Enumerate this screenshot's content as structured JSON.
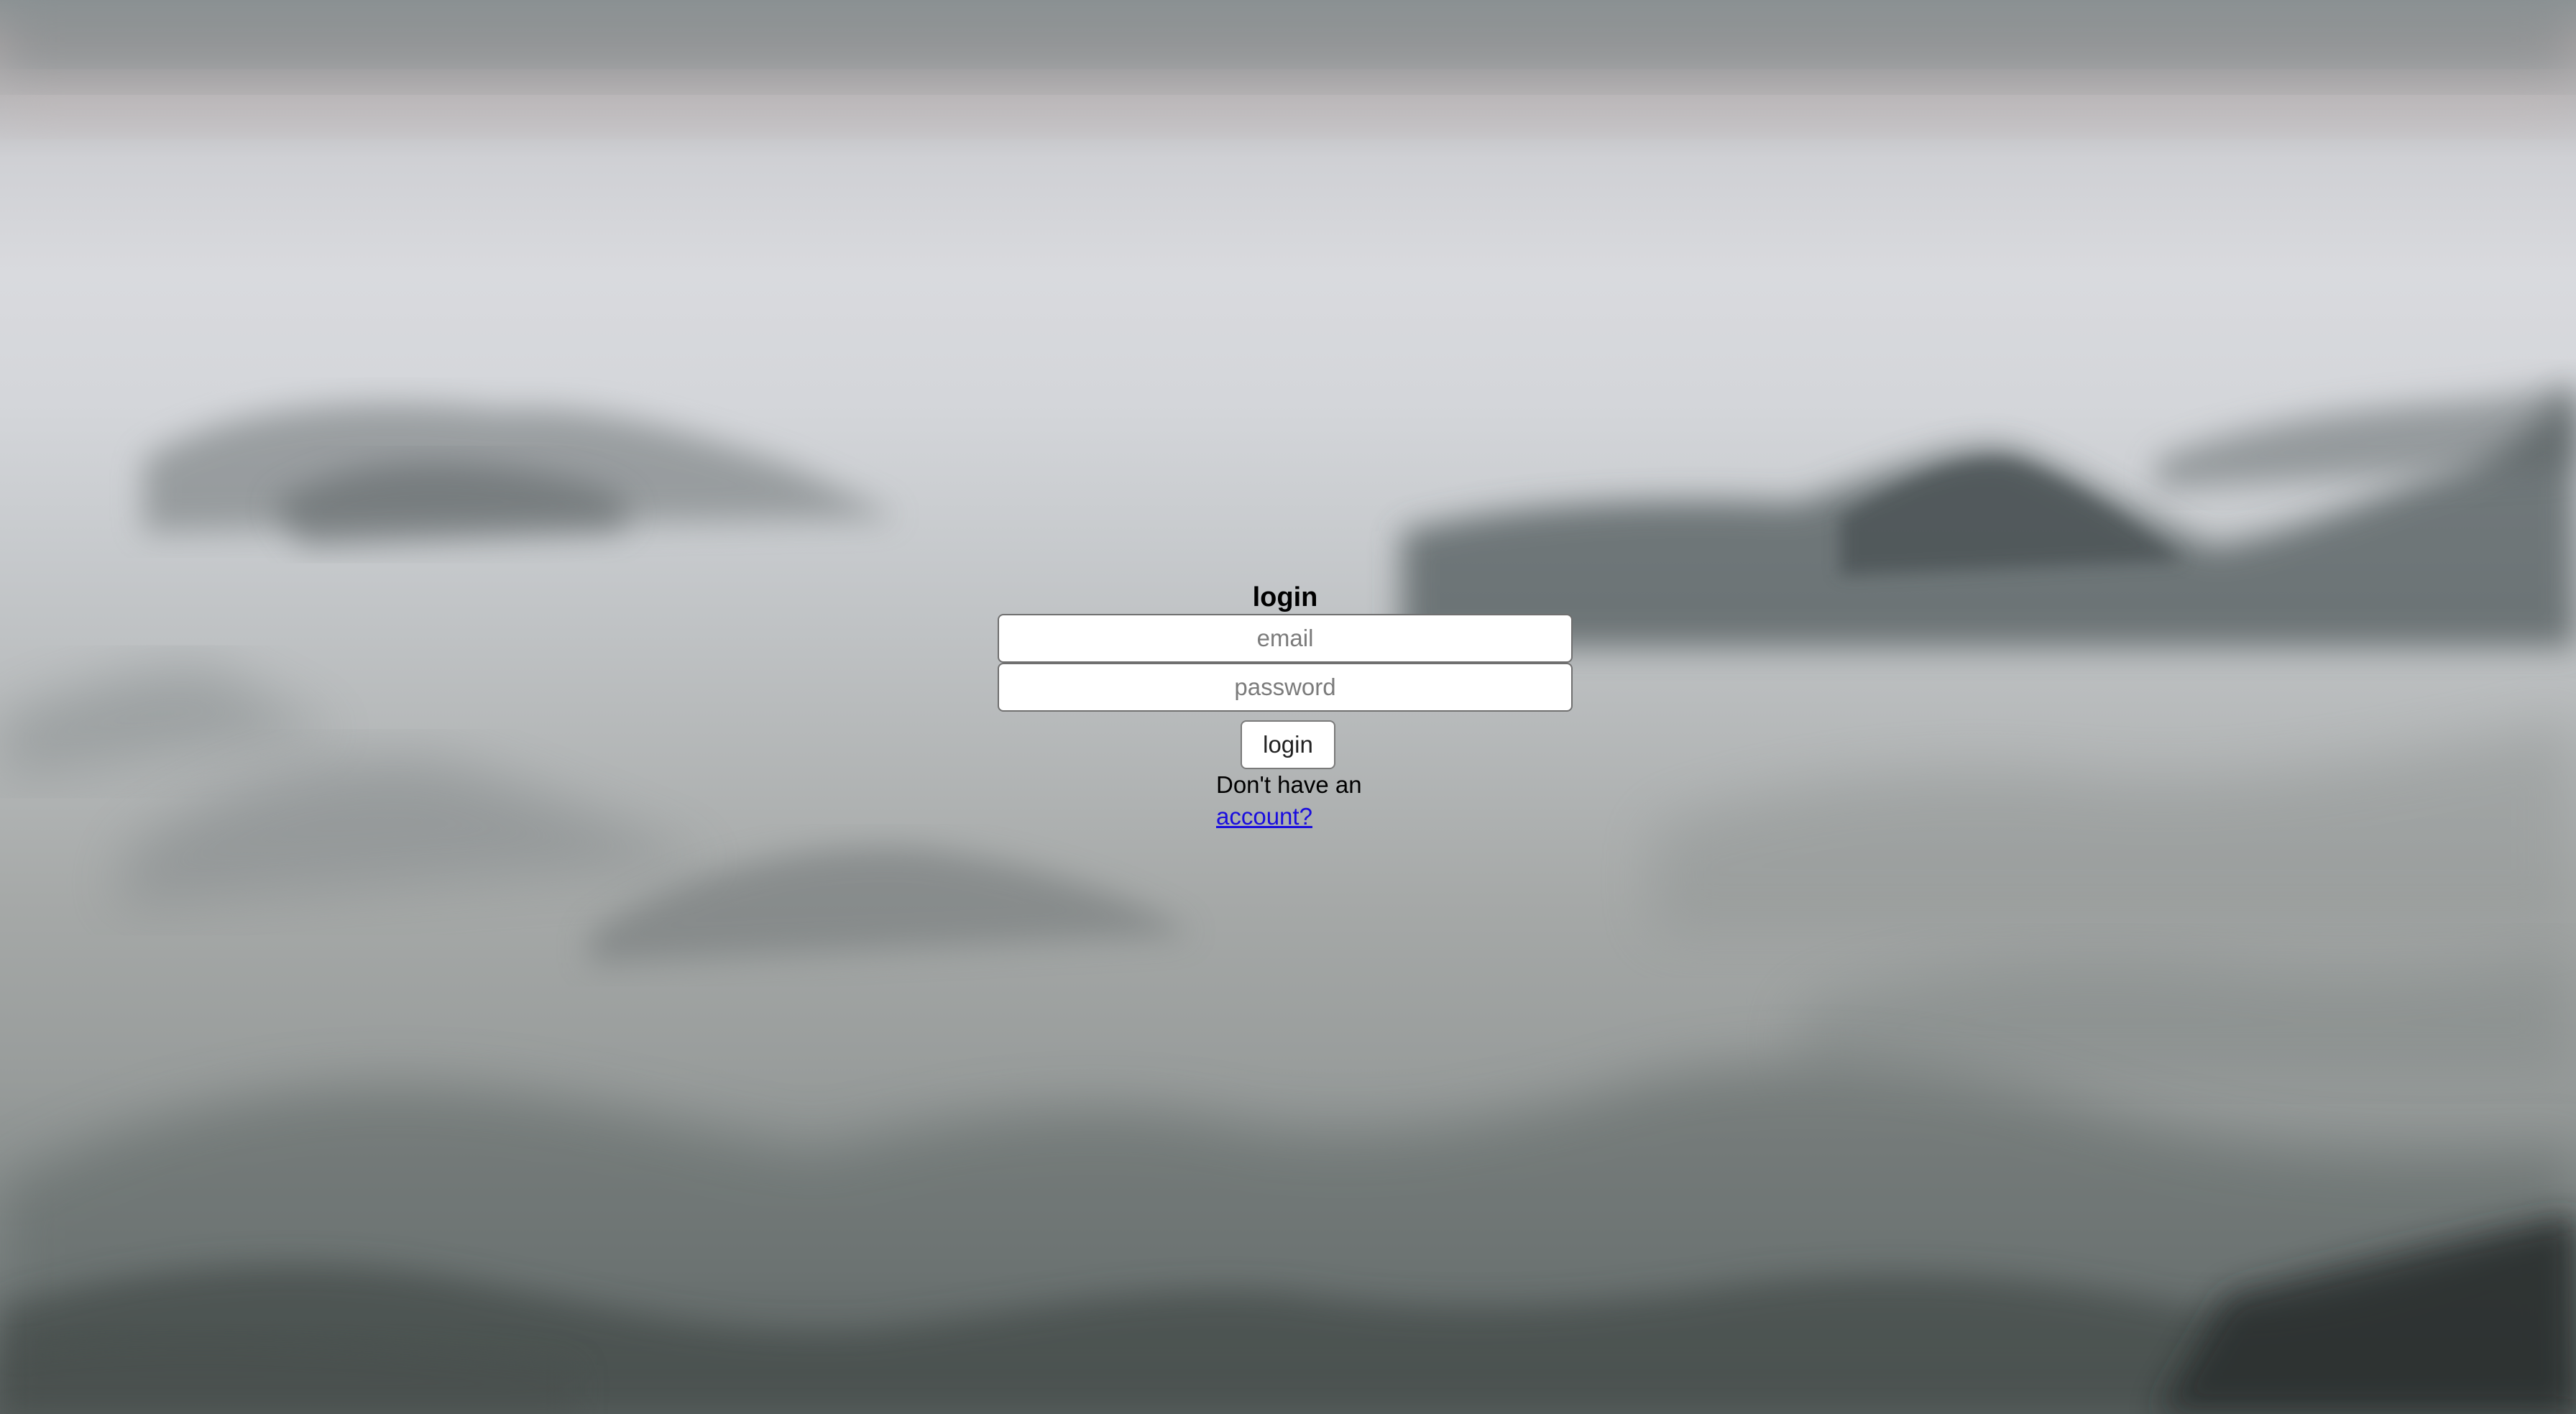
{
  "login": {
    "title": "login",
    "email_placeholder": "email",
    "password_placeholder": "password",
    "button_label": "login",
    "signup_prompt": "Don't have an",
    "signup_link": "account?"
  },
  "colors": {
    "link": "#1a0dde",
    "field_border": "#6f6f6f",
    "field_background": "#ffffff"
  }
}
